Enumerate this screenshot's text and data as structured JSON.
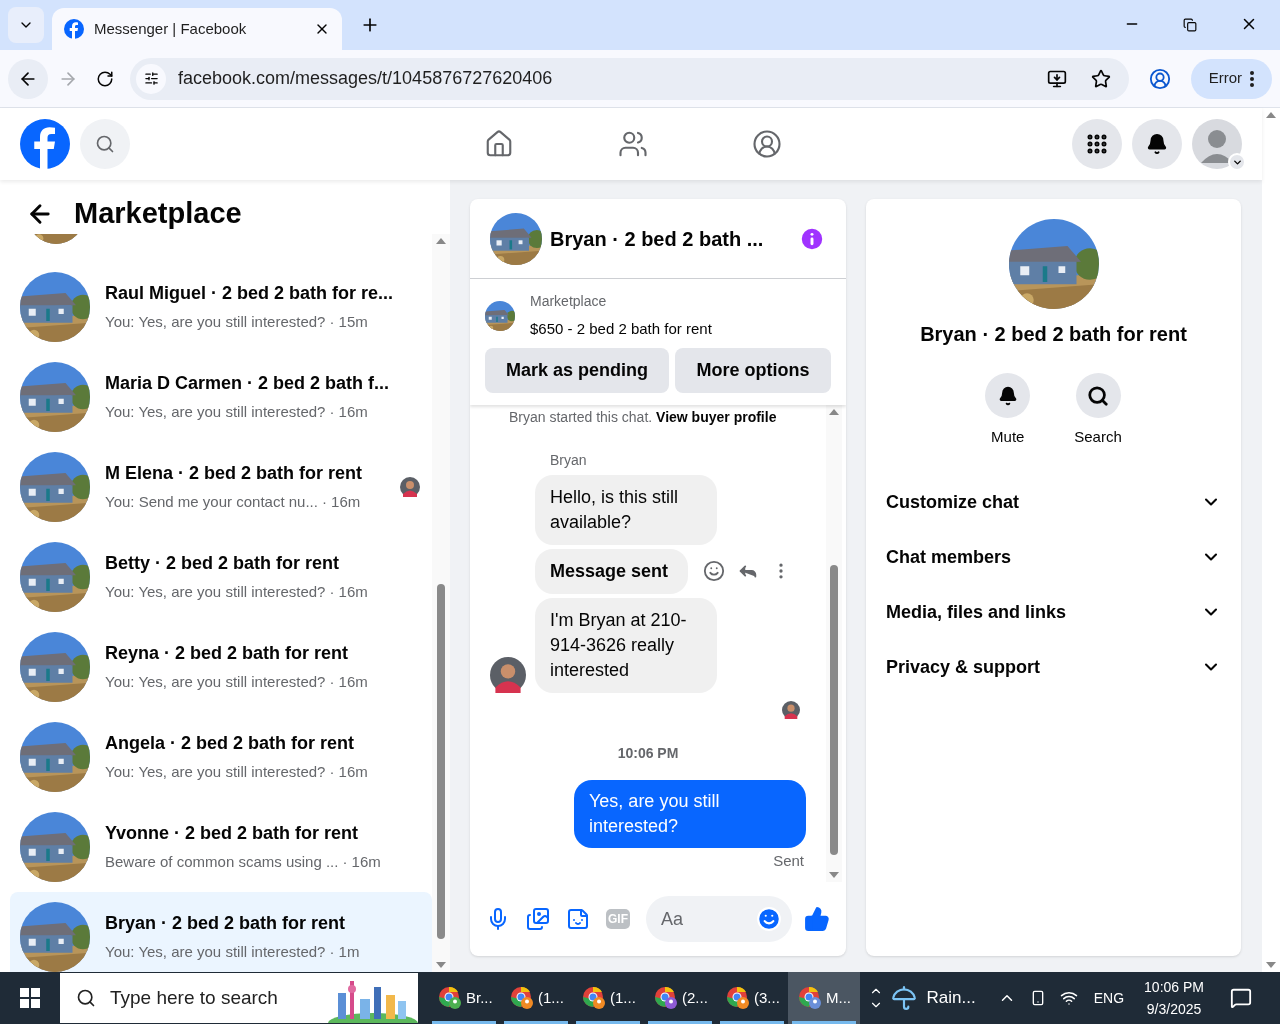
{
  "browser": {
    "tab_title": "Messenger | Facebook",
    "url": "facebook.com/messages/t/1045876727620406",
    "profile_button": "Error"
  },
  "sidebar": {
    "title": "Marketplace",
    "conversations": [
      {
        "name": "Raul Miguel · 2 bed 2 bath for re...",
        "preview": "You: Yes, are you still interested?",
        "time": "· 15m",
        "seen": false,
        "selected": false
      },
      {
        "name": "Maria D Carmen · 2 bed 2 bath f...",
        "preview": "You: Yes, are you still interested?",
        "time": "· 16m",
        "seen": false,
        "selected": false
      },
      {
        "name": "M Elena · 2 bed 2 bath for rent",
        "preview": "You: Send me your contact nu...",
        "time": "· 16m",
        "seen": true,
        "selected": false
      },
      {
        "name": "Betty · 2 bed 2 bath for rent",
        "preview": "You: Yes, are you still interested?",
        "time": "· 16m",
        "seen": false,
        "selected": false
      },
      {
        "name": "Reyna · 2 bed 2 bath for rent",
        "preview": "You: Yes, are you still interested?",
        "time": "· 16m",
        "seen": false,
        "selected": false
      },
      {
        "name": "Angela · 2 bed 2 bath for rent",
        "preview": "You: Yes, are you still interested?",
        "time": "· 16m",
        "seen": false,
        "selected": false
      },
      {
        "name": "Yvonne · 2 bed 2 bath for rent",
        "preview": "Beware of common scams using ...",
        "time": "· 16m",
        "seen": false,
        "selected": false
      },
      {
        "name": "Bryan · 2 bed 2 bath for rent",
        "preview": "You: Yes, are you still interested?",
        "time": "· 1m",
        "seen": false,
        "selected": true
      }
    ]
  },
  "chat": {
    "title": "Bryan · 2 bed 2 bath ...",
    "listing": {
      "source": "Marketplace",
      "summary": "$650 - 2 bed 2 bath for rent"
    },
    "buttons": [
      "Mark as pending",
      "More options"
    ],
    "messages": [
      {
        "kind": "notice",
        "text": "Bryan started this chat.",
        "link": "View buyer profile"
      },
      {
        "kind": "sender",
        "text": "Bryan"
      },
      {
        "kind": "incoming",
        "text": "Hello, is this still available?",
        "bold": false,
        "hovered": false,
        "avatar": false
      },
      {
        "kind": "incoming",
        "text": "Message sent",
        "bold": true,
        "hovered": true,
        "avatar": false
      },
      {
        "kind": "incoming",
        "text": "I'm Bryan at 210-914-3626 really interested",
        "bold": false,
        "hovered": false,
        "avatar": true
      },
      {
        "kind": "seen"
      },
      {
        "kind": "time",
        "text": "10:06 PM"
      },
      {
        "kind": "outgoing",
        "text": "Yes, are you still interested?"
      },
      {
        "kind": "status",
        "text": "Sent"
      }
    ],
    "composer": {
      "gif_label": "GIF",
      "placeholder": "Aa"
    }
  },
  "details": {
    "title": "Bryan · 2 bed 2 bath for rent",
    "actions": [
      {
        "kind": "mute",
        "label": "Mute"
      },
      {
        "kind": "search",
        "label": "Search"
      }
    ],
    "sections": [
      {
        "label": "Customize chat",
        "expanded": false
      },
      {
        "label": "Chat members",
        "expanded": false
      },
      {
        "label": "Media, files and links",
        "expanded": false
      },
      {
        "label": "Privacy & support",
        "expanded": false
      }
    ]
  },
  "taskbar": {
    "search_placeholder": "Type here to search",
    "apps": [
      {
        "label": "Br...",
        "selected": false,
        "color": "#4caf50"
      },
      {
        "label": "(1...",
        "selected": false,
        "color": "#f08a24"
      },
      {
        "label": "(1...",
        "selected": false,
        "color": "#f08a24"
      },
      {
        "label": "(2...",
        "selected": false,
        "color": "#8e5bd6"
      },
      {
        "label": "(3...",
        "selected": false,
        "color": "#f08a24"
      },
      {
        "label": "M...",
        "selected": true,
        "color": "#6a8fd8"
      }
    ],
    "weather": "Rain...",
    "language": "ENG",
    "time": "10:06 PM",
    "date": "9/3/2025"
  }
}
